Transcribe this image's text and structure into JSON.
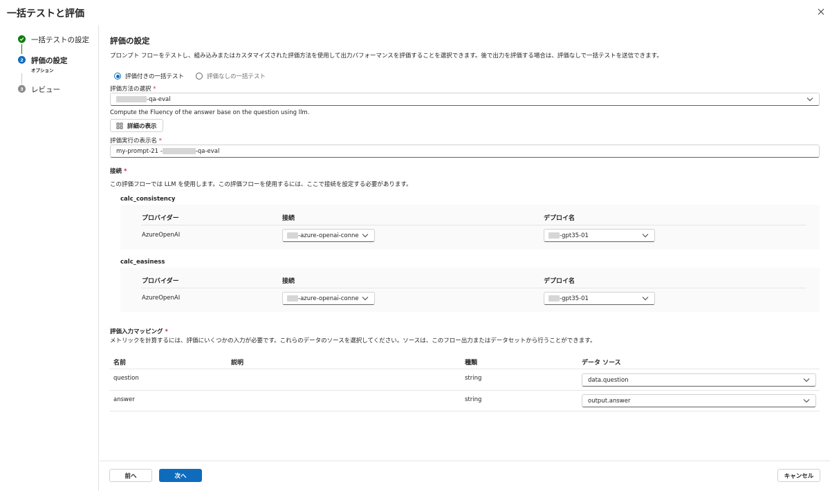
{
  "title": "一括テストと評価",
  "steps": [
    {
      "label": "一括テストの設定",
      "sub": "",
      "state": "done"
    },
    {
      "label": "評価の設定",
      "sub": "オプション",
      "state": "current",
      "num": "2"
    },
    {
      "label": "レビュー",
      "sub": "",
      "state": "pending",
      "num": "3"
    }
  ],
  "main": {
    "heading": "評価の設定",
    "description": "プロンプト フローをテストし、組み込みまたはカスタマイズされた評価方法を使用して出力パフォーマンスを評価することを選択できます。後で出力を評価する場合は、評価なしで一括テストを送信できます。",
    "radio_with": "評価付きの一括テスト",
    "radio_without": "評価なしの一括テスト",
    "method_label": "評価方法の選択",
    "method_value": "-qa-eval",
    "method_desc": "Compute the Fluency of the answer base on the question using llm.",
    "details_button": "詳細の表示",
    "run_name_label": "評価実行の表示名",
    "run_name_prefix": "my-prompt-21 - ",
    "run_name_suffix": "-qa-eval",
    "required_mark": "*",
    "connection_label": "接続",
    "connection_desc": "この評価フローでは LLM を使用します。この評価フローを使用するには、ここで接続を設定する必要があります。"
  },
  "connections": [
    {
      "name": "calc_consistency",
      "headers": {
        "provider": "プロバイダー",
        "connection": "接続",
        "deploy": "デプロイ名"
      },
      "provider": "AzureOpenAI",
      "connection": "-azure-openai-connect",
      "deploy": "-gpt35-01"
    },
    {
      "name": "calc_easiness",
      "headers": {
        "provider": "プロバイダー",
        "connection": "接続",
        "deploy": "デプロイ名"
      },
      "provider": "AzureOpenAI",
      "connection": "-azure-openai-connect",
      "deploy": "-gpt35-01"
    }
  ],
  "mapping": {
    "label": "評価入力マッピング",
    "desc": "メトリックを計算するには、評価にいくつかの入力が必要です。これらのデータのソースを選択してください。ソースは、このフロー出力またはデータセットから行うことができます。",
    "headers": {
      "name": "名前",
      "desc": "説明",
      "type": "種類",
      "source": "データ ソース"
    },
    "rows": [
      {
        "name": "question",
        "desc": "",
        "type": "string",
        "source": "data.question"
      },
      {
        "name": "answer",
        "desc": "",
        "type": "string",
        "source": "output.answer"
      }
    ]
  },
  "footer": {
    "prev": "前へ",
    "next": "次へ",
    "cancel": "キャンセル"
  },
  "colors": {
    "accent": "#0f6cbd",
    "success": "#107c10",
    "required": "#c4314b"
  }
}
